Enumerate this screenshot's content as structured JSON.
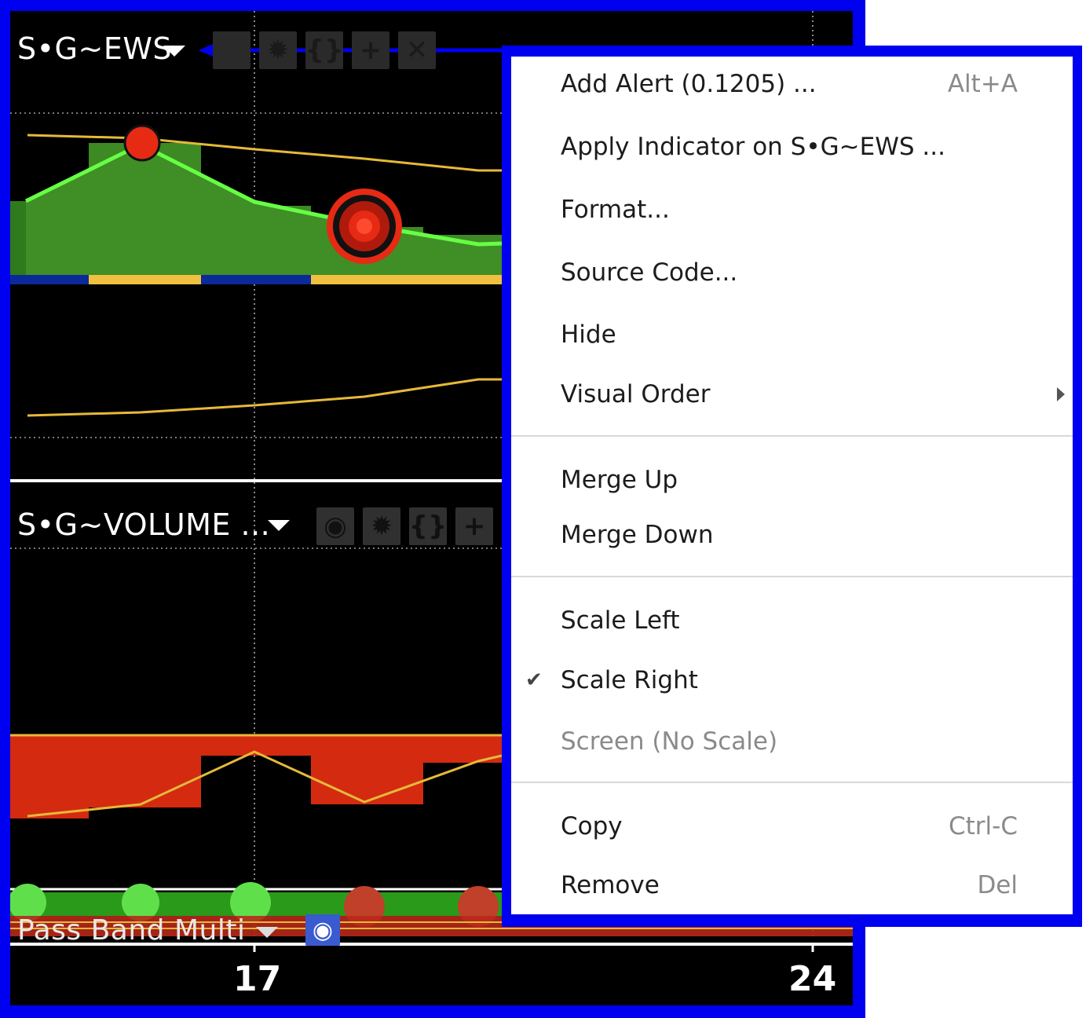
{
  "panels": {
    "ews_title": "S•G~EWS",
    "volume_title": "S•G~VOLUME ...",
    "pass_band_title": "Pass Band Multi"
  },
  "toolbar_icons": [
    "eye-icon",
    "gear-icon",
    "braces-icon",
    "plus-icon",
    "close-icon"
  ],
  "axis": {
    "x_ticks": [
      "17",
      "24"
    ]
  },
  "menu": {
    "items": [
      {
        "label": "Add Alert (0.1205) ...",
        "shortcut": "Alt+A"
      },
      {
        "label": "Apply Indicator on S•G~EWS ..."
      },
      {
        "label": "Format..."
      },
      {
        "label": "Source Code..."
      },
      {
        "label": "Hide"
      },
      {
        "label": "Visual Order"
      },
      {
        "label": "Merge Up"
      },
      {
        "label": "Merge Down"
      },
      {
        "label": "Scale Left"
      },
      {
        "label": "Scale Right",
        "checked": true
      },
      {
        "label": "Screen (No Scale)",
        "disabled": true
      },
      {
        "label": "Copy",
        "shortcut": "Ctrl-C"
      },
      {
        "label": "Remove",
        "shortcut": "Del"
      }
    ]
  },
  "colors": {
    "frame_blue": "#0000f0",
    "area_green": "#3d8a24",
    "line_green": "#66ff44",
    "line_yellow": "#e6b93a",
    "volume_red": "#d42a10",
    "marker_red": "#e62a14",
    "band_yellow": "#f0c040",
    "band_blue": "#0a2a9a"
  }
}
